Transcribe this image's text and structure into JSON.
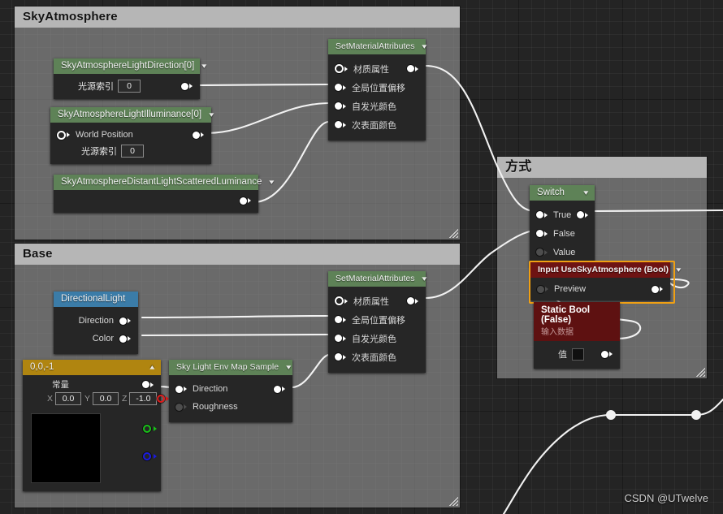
{
  "comments": [
    {
      "title": "SkyAtmosphere"
    },
    {
      "title": "Base"
    },
    {
      "title": "方式"
    }
  ],
  "nodes": {
    "sky_light_direction": {
      "title": "SkyAtmosphereLightDirection[0]",
      "rows": [
        {
          "label": "光源索引",
          "value": "0"
        }
      ]
    },
    "sky_light_illuminance": {
      "title": "SkyAtmosphereLightIlluminance[0]",
      "rows": [
        {
          "label": "World Position"
        },
        {
          "label": "光源索引",
          "value": "0"
        }
      ]
    },
    "sky_distant_luminance": {
      "title": "SkyAtmosphereDistantLightScatteredLuminance"
    },
    "set_material_attributes_top": {
      "title": "SetMaterialAttributes",
      "rows": [
        {
          "label": "材质属性"
        },
        {
          "label": "全局位置偏移"
        },
        {
          "label": "自发光颜色"
        },
        {
          "label": "次表面颜色"
        }
      ]
    },
    "set_material_attributes_bottom": {
      "title": "SetMaterialAttributes",
      "rows": [
        {
          "label": "材质属性"
        },
        {
          "label": "全局位置偏移"
        },
        {
          "label": "自发光颜色"
        },
        {
          "label": "次表面颜色"
        }
      ]
    },
    "directional_light": {
      "title": "DirectionalLight",
      "rows": [
        {
          "label": "Direction"
        },
        {
          "label": "Color"
        }
      ]
    },
    "constant_vector": {
      "title": "0,0,-1",
      "label": "常量",
      "axes": [
        {
          "name": "X",
          "value": "0.0"
        },
        {
          "name": "Y",
          "value": "0.0"
        },
        {
          "name": "Z",
          "value": "-1.0"
        }
      ],
      "preview_color": "#000000"
    },
    "sky_light_env_map": {
      "title": "Sky Light Env Map Sample",
      "rows": [
        {
          "label": "Direction"
        },
        {
          "label": "Roughness"
        }
      ]
    },
    "switch": {
      "title": "Switch",
      "rows": [
        {
          "label": "True"
        },
        {
          "label": "False"
        },
        {
          "label": "Value"
        }
      ]
    },
    "input_use_sky_atmosphere": {
      "title": "Input UseSkyAtmosphere (Bool)",
      "rows": [
        {
          "label": "Preview"
        }
      ],
      "selected": true,
      "selection_color": "#f0a013"
    },
    "static_bool": {
      "title": "Static Bool (False)",
      "subtitle": "输入数据",
      "rows": [
        {
          "label": "值",
          "checked": false
        }
      ]
    }
  },
  "watermark": "CSDN @UTwelve"
}
